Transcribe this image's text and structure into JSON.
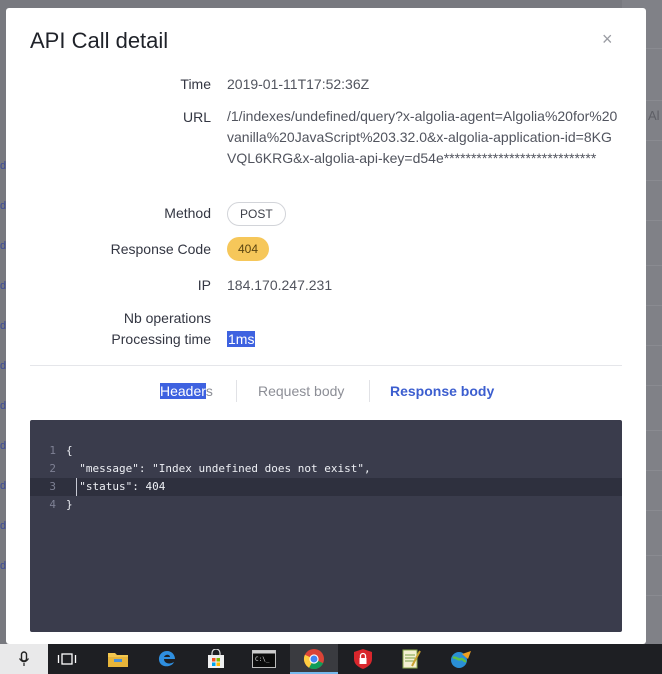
{
  "modal": {
    "title": "API Call detail",
    "close_glyph": "×"
  },
  "fields": {
    "time_label": "Time",
    "time_value": "2019-01-11T17:52:36Z",
    "url_label": "URL",
    "url_value": "/1/indexes/undefined/query?x-algolia-agent=Algolia%20for%20vanilla%20JavaScript%203.32.0&x-algolia-application-id=8KGVQL6KRG&x-algolia-api-key=d54e****************************",
    "method_label": "Method",
    "method_value": "POST",
    "response_code_label": "Response Code",
    "response_code_value": "404",
    "ip_label": "IP",
    "ip_value": "184.170.247.231",
    "nb_operations_label": "Nb operations",
    "processing_time_label": "Processing time",
    "processing_time_value": "1ms"
  },
  "tabs": {
    "headers_highlighted": "Header",
    "headers_rest": "s",
    "request_body": "Request body",
    "response_body": "Response body"
  },
  "code": {
    "lines": [
      {
        "number": "1",
        "text": "{"
      },
      {
        "number": "2",
        "text": "  \"message\": \"Index undefined does not exist\","
      },
      {
        "number": "3",
        "text": "  \"status\": 404"
      },
      {
        "number": "4",
        "text": "}"
      }
    ],
    "active_line": 3
  },
  "background": {
    "right_fragment": "Al"
  },
  "taskbar": {
    "items": [
      "microphone-icon",
      "task-view-icon",
      "file-explorer-icon",
      "edge-icon",
      "store-icon",
      "terminal-icon",
      "chrome-icon",
      "vpn-shield-icon",
      "notepad-icon",
      "network-globe-icon"
    ],
    "active_item": "chrome-icon",
    "colors": {
      "background": "#1e1f23",
      "accent": "#76b9ed"
    }
  },
  "colors": {
    "response_code_badge": "#f6c75a",
    "active_tab": "#3c5ecf",
    "selection": "#3e62e0",
    "code_background": "#3a3c4c"
  }
}
